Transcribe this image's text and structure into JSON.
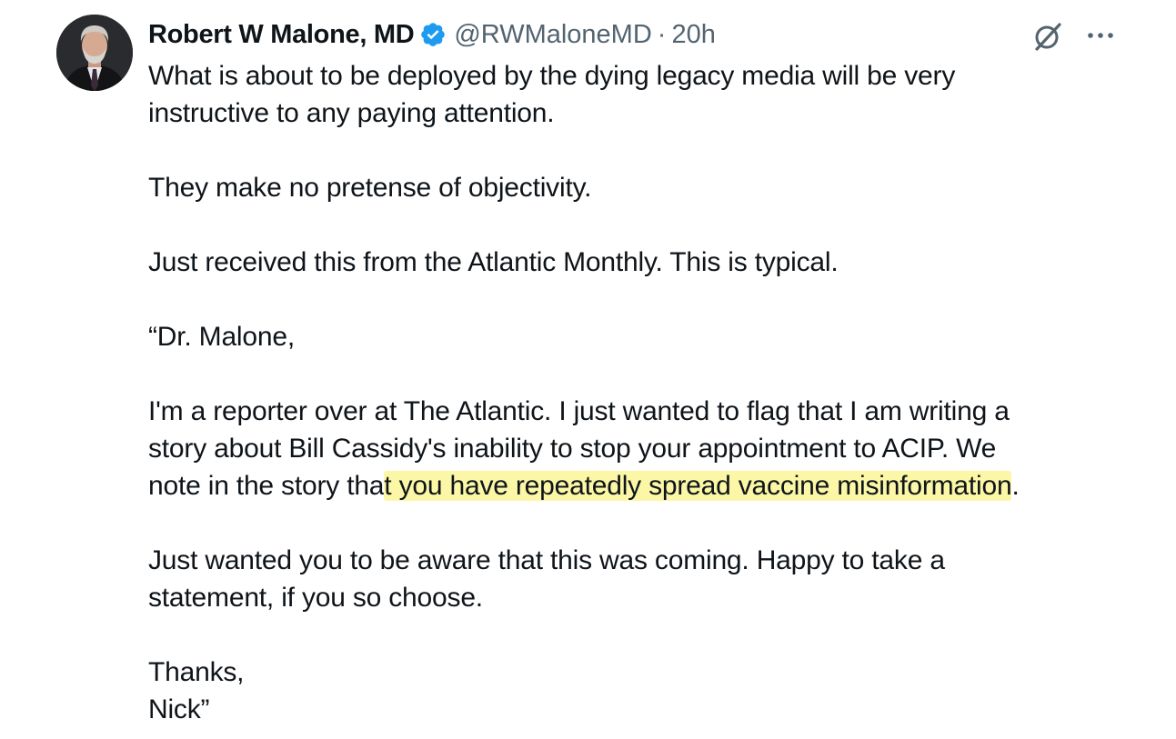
{
  "author": {
    "name": "Robert W Malone, MD",
    "handle": "@RWMaloneMD",
    "separator": "·",
    "time": "20h"
  },
  "icons": {
    "verified": "verified-badge-icon",
    "grok": "grok-icon",
    "more": "more-options-icon"
  },
  "colors": {
    "verified_blue": "#1d9bf0",
    "highlight": "#fbf7a6",
    "muted_text": "#536471"
  },
  "tweet": {
    "p1_l1": "What is about to be deployed by the dying legacy media will be very",
    "p1_l2": "instructive to any paying attention.",
    "p2": "They make no pretense of objectivity.",
    "p3": "Just received this from the Atlantic Monthly.  This is typical.",
    "p4": "“Dr. Malone,",
    "p5_l1": "I'm a reporter over at The Atlantic. I just wanted to flag that I am writing a",
    "p5_l2": "story about Bill Cassidy's inability to stop your appointment to ACIP. We",
    "p5_l3_pre": "note in the story tha",
    "p5_l3_highlight": "t you have repeatedly spread vaccine misinformation",
    "p5_l3_post": ".",
    "p6_l1": "Just wanted you to be aware that this was coming. Happy to take a",
    "p6_l2": "statement, if you so choose.",
    "p7_l1": "Thanks,",
    "p7_l2": "Nick”"
  }
}
